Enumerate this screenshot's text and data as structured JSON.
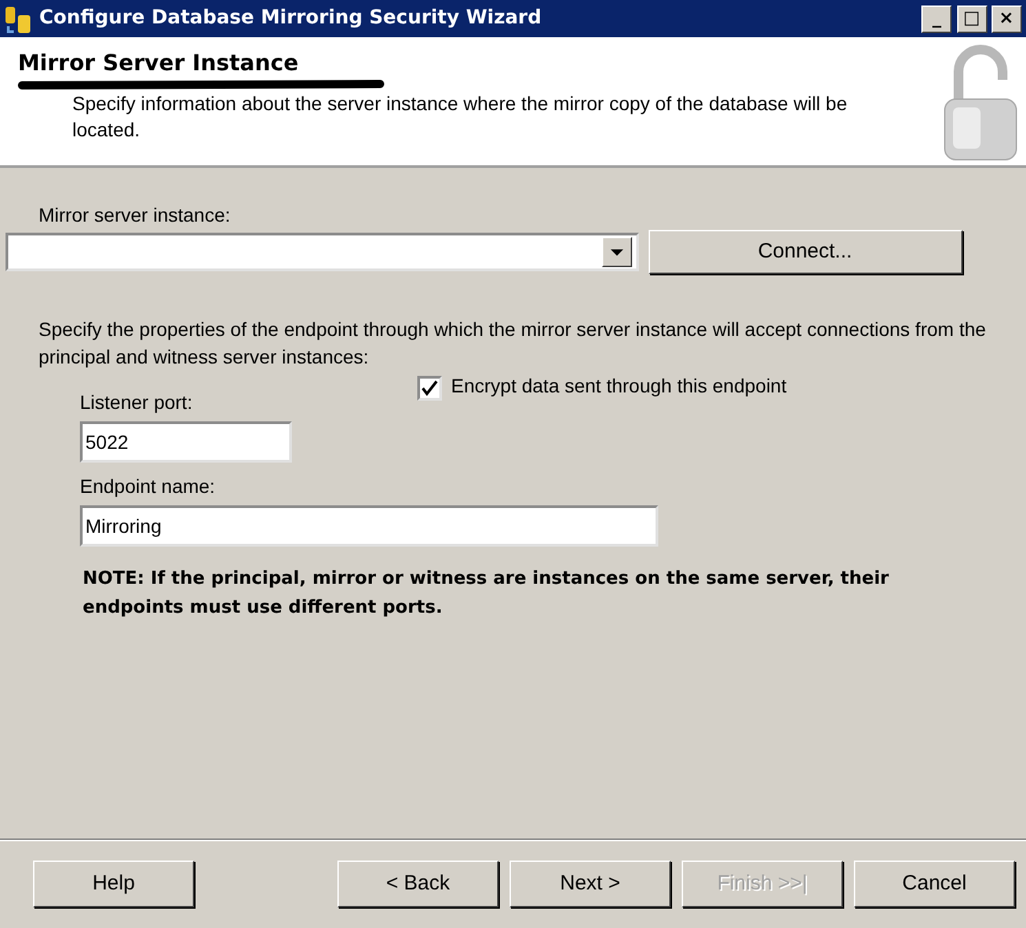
{
  "window": {
    "title": "Configure Database Mirroring Security Wizard",
    "controls": [
      "_",
      "□",
      "×"
    ]
  },
  "header": {
    "title": "Mirror Server Instance",
    "subtitle": "Specify information about the server instance where the mirror copy of the database will be located."
  },
  "server": {
    "label": "Mirror server instance:",
    "connect": "Connect..."
  },
  "intro": "Specify the properties of the endpoint through which the mirror server instance will accept connections from the principal and witness server instances:",
  "listener": {
    "label": "Listener port:",
    "value": "5022"
  },
  "encrypt": {
    "label": "Encrypt data sent through this endpoint",
    "checked": true
  },
  "endpoint": {
    "label": "Endpoint name:",
    "value": "Mirroring"
  },
  "note": "NOTE: If the principal, mirror or witness are instances on the same server, their endpoints must use different ports.",
  "buttons": [
    {
      "label": "Help",
      "disabled": false
    },
    {
      "label": "< Back",
      "disabled": false
    },
    {
      "label": "Next >",
      "disabled": false
    },
    {
      "label": "Finish >>|",
      "disabled": true
    },
    {
      "label": "Cancel",
      "disabled": false
    }
  ]
}
